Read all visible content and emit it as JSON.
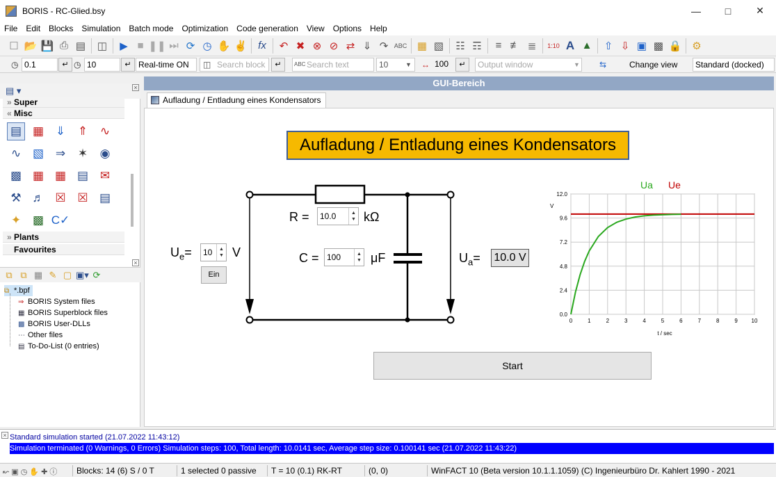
{
  "window": {
    "title": "BORIS - RC-Glied.bsy"
  },
  "menu": [
    "File",
    "Edit",
    "Blocks",
    "Simulation",
    "Batch mode",
    "Optimization",
    "Code generation",
    "View",
    "Options",
    "Help"
  ],
  "toolbar2": {
    "step_size": "0.1",
    "sim_time": "10",
    "realtime": "Real-time ON",
    "search_block_placeholder": "Search block",
    "search_text_placeholder": "Search text",
    "font_size": "10",
    "width_value": "100",
    "output_window_placeholder": "Output window",
    "change_view": "Change view",
    "docking": "Standard (docked)"
  },
  "library": {
    "categories": {
      "super": "Super",
      "misc": "Misc",
      "plants": "Plants",
      "favourites": "Favourites"
    }
  },
  "project_tree": {
    "root": "*.bpf",
    "items": [
      "BORIS System files",
      "BORIS Superblock files",
      "BORIS User-DLLs",
      "Other files",
      "To-Do-List (0 entries)"
    ]
  },
  "gui": {
    "header": "GUI-Bereich",
    "tab": "Aufladung / Entladung eines Kondensators",
    "title": "Aufladung / Entladung eines Kondensators",
    "r_label": "R =",
    "r_value": "10.0",
    "r_unit": "kΩ",
    "c_label": "C =",
    "c_value": "100",
    "c_unit": "μF",
    "ue_sym": "U",
    "ue_sub": "e",
    "ue_eq": "=",
    "ue_value": "10",
    "ue_unit": "V",
    "ein_button": "Ein",
    "ua_sym": "U",
    "ua_sub": "a",
    "ua_eq": "=",
    "ua_value": "10.0 V",
    "start_button": "Start"
  },
  "chart_data": {
    "type": "line",
    "title": "",
    "xlabel": "t / sec",
    "ylabel": "V",
    "xlim": [
      0,
      10
    ],
    "ylim": [
      0,
      12
    ],
    "xticks": [
      "0",
      "1",
      "2",
      "3",
      "4",
      "5",
      "6",
      "7",
      "8",
      "9",
      "10"
    ],
    "yticks": [
      "0.0",
      "2.4",
      "4.8",
      "7.2",
      "9.6",
      "12.0"
    ],
    "grid": true,
    "series": [
      {
        "name": "Ua",
        "color": "#2aa81e",
        "x": [
          0,
          0.25,
          0.5,
          0.75,
          1,
          1.5,
          2,
          2.5,
          3,
          3.5,
          4,
          4.5,
          5,
          5.5,
          6
        ],
        "y": [
          0,
          2.21,
          3.93,
          5.28,
          6.32,
          7.77,
          8.65,
          9.18,
          9.5,
          9.7,
          9.82,
          9.89,
          9.93,
          9.96,
          9.98
        ]
      },
      {
        "name": "Ue",
        "color": "#c00000",
        "x": [
          0,
          10
        ],
        "y": [
          10,
          10
        ]
      }
    ],
    "legend": "top"
  },
  "log": {
    "line1": "Standard simulation started   (21.07.2022 11:43:12)",
    "line2": "Simulation terminated (0 Warnings, 0 Errors)   Simulation steps: 100, Total length:    10.0141 sec, Average step size:   0.100141 sec   (21.07.2022 11:43:22)"
  },
  "status": {
    "blocks": "Blocks: 14 (6) S / 0 T",
    "selected": "1 selected  0 passive",
    "time": "T = 10  (0.1)  RK-RT",
    "coords": "(0, 0)",
    "version": "WinFACT 10 (Beta version 10.1.1.1059)  (C) Ingenieurbüro Dr. Kahlert 1990 - 2021"
  }
}
